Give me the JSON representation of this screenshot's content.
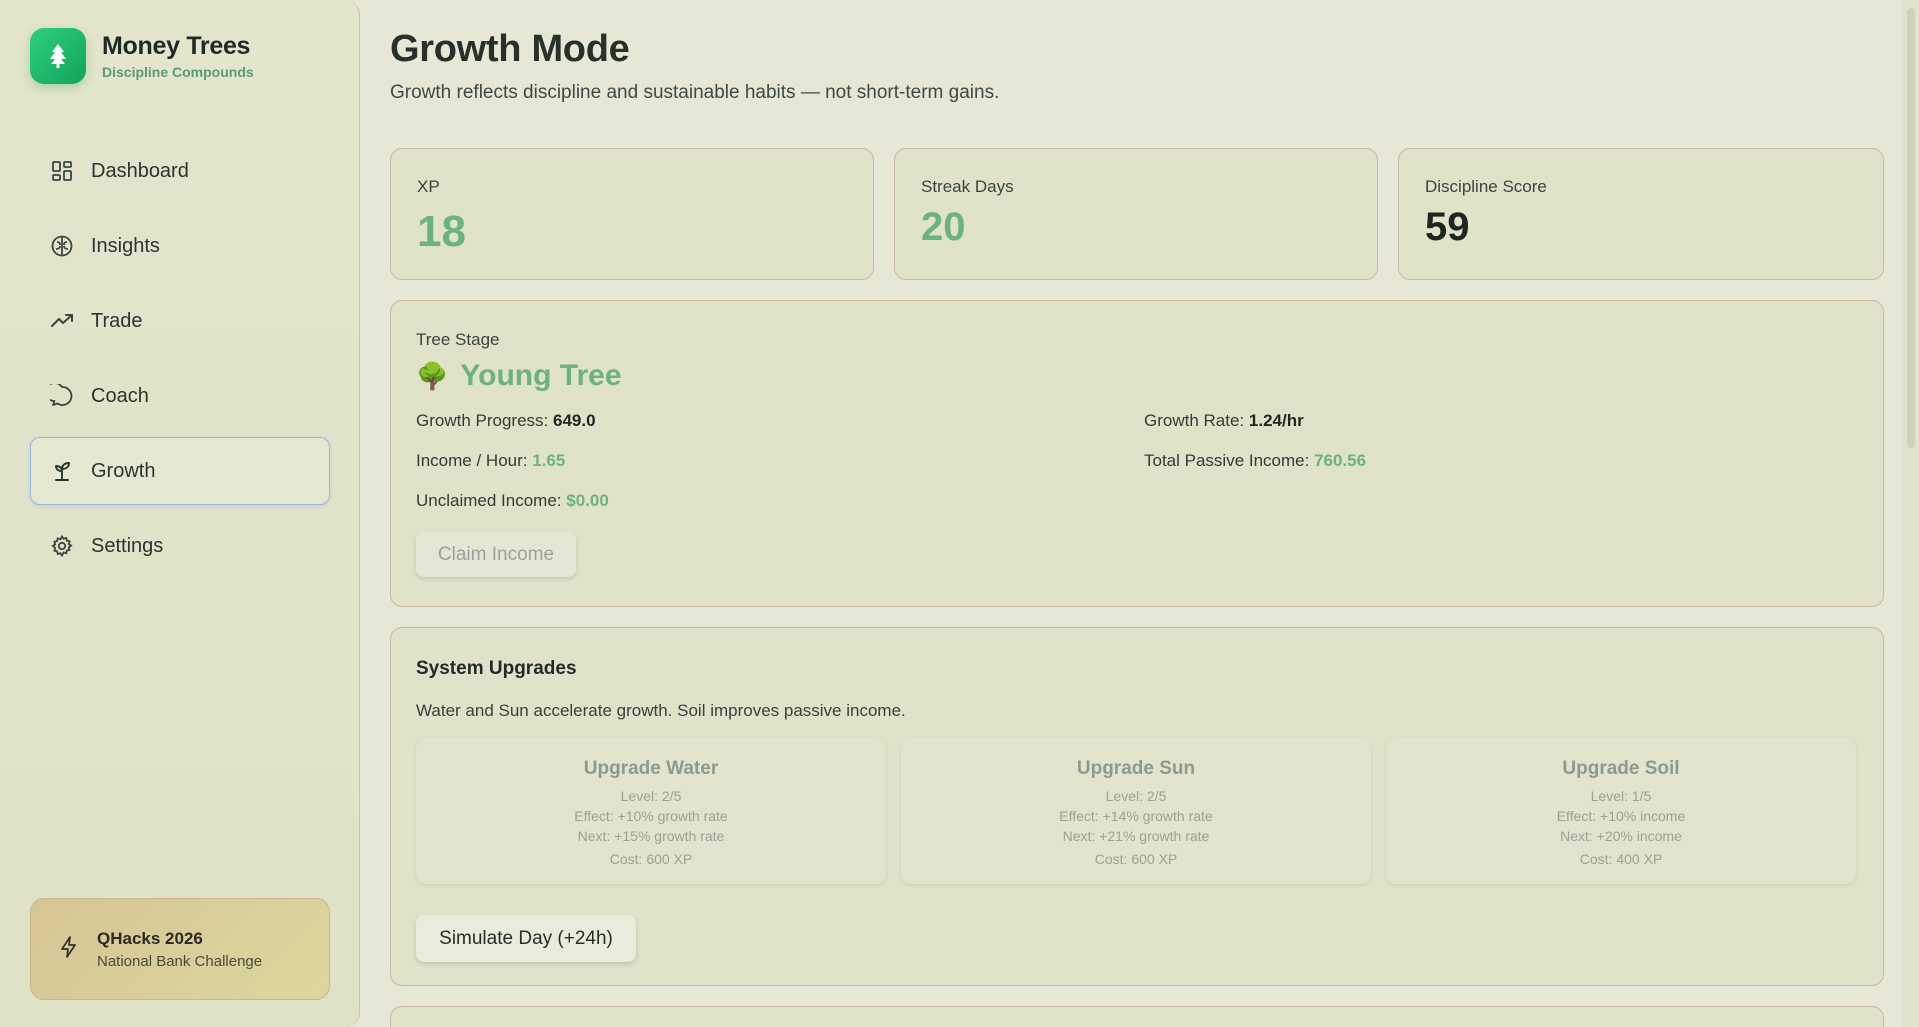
{
  "brand": {
    "name": "Money Trees",
    "tagline": "Discipline Compounds",
    "logo_icon": "tree-icon"
  },
  "nav": [
    {
      "label": "Dashboard",
      "icon": "dashboard-icon"
    },
    {
      "label": "Insights",
      "icon": "brain-icon"
    },
    {
      "label": "Trade",
      "icon": "trending-up-icon"
    },
    {
      "label": "Coach",
      "icon": "chat-icon"
    },
    {
      "label": "Growth",
      "icon": "sprout-icon",
      "active": true
    },
    {
      "label": "Settings",
      "icon": "gear-icon"
    }
  ],
  "promo": {
    "title": "QHacks 2026",
    "subtitle": "National Bank Challenge",
    "icon": "lightning-icon"
  },
  "page": {
    "title": "Growth Mode",
    "subtitle": "Growth reflects discipline and sustainable habits — not short-term gains."
  },
  "stats": [
    {
      "label": "XP",
      "value": "18"
    },
    {
      "label": "Streak Days",
      "value": "20"
    },
    {
      "label": "Discipline Score",
      "value": "59"
    }
  ],
  "tree": {
    "label": "Tree Stage",
    "stage_emoji": "🌳",
    "stage": "Young Tree",
    "growth_progress_label": "Growth Progress:",
    "growth_progress": "649.0",
    "growth_rate_label": "Growth Rate:",
    "growth_rate": "1.24/hr",
    "income_hour_label": "Income / Hour:",
    "income_hour": "1.65",
    "total_passive_label": "Total Passive Income:",
    "total_passive": "760.56",
    "unclaimed_label": "Unclaimed Income:",
    "unclaimed": "$0.00",
    "claim_button": "Claim Income"
  },
  "upgrades": {
    "title": "System Upgrades",
    "description": "Water and Sun accelerate growth. Soil improves passive income.",
    "items": [
      {
        "title": "Upgrade Water",
        "level": "Level: 2/5",
        "effect": "Effect: +10% growth rate",
        "next": "Next: +15% growth rate",
        "cost": "Cost: 600 XP"
      },
      {
        "title": "Upgrade Sun",
        "level": "Level: 2/5",
        "effect": "Effect: +14% growth rate",
        "next": "Next: +21% growth rate",
        "cost": "Cost: 600 XP"
      },
      {
        "title": "Upgrade Soil",
        "level": "Level: 1/5",
        "effect": "Effect: +10% income",
        "next": "Next: +20% income",
        "cost": "Cost: 400 XP"
      }
    ],
    "simulate_button": "Simulate Day (+24h)"
  }
}
